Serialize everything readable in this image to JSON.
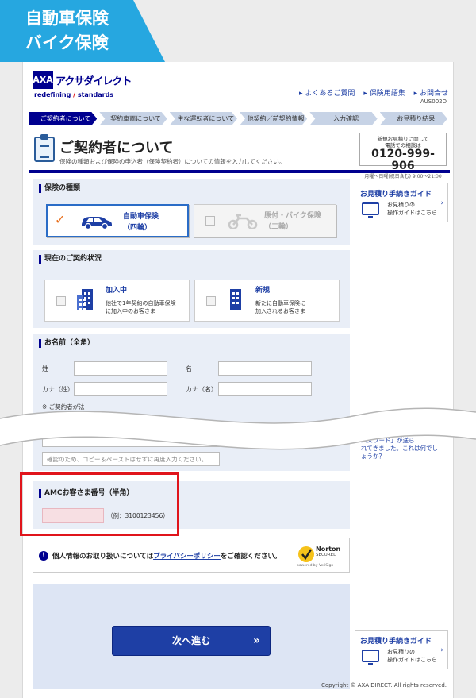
{
  "tag": {
    "line1": "自動車保険",
    "line2": "バイク保険"
  },
  "header": {
    "brand": "アクサダイレクト",
    "tagline_left": "redefining",
    "tagline_right": "standards",
    "links": [
      "よくあるご質問",
      "保険用語集",
      "お問合せ"
    ],
    "page_code": "AUS002D"
  },
  "steps": [
    "ご契約者について",
    "契約車両について",
    "主な運転者について",
    "他契約／前契約情報",
    "入力確認",
    "お見積り結果"
  ],
  "title": {
    "main": "ご契約者について",
    "sub": "保険の種類および保険の申込者（保険契約者）についての情報を入力してください。"
  },
  "phone": {
    "line1": "新規お見積りに関して",
    "line2": "電話での相談は",
    "number": "0120-999-906",
    "hours": "月曜～日曜(祝日含む) 9:00～21:00"
  },
  "insurance_type": {
    "title": "保険の種類",
    "auto": {
      "label1": "自動車保険",
      "label2": "（四輪）"
    },
    "bike": {
      "label1": "原付・バイク保険",
      "label2": "（二輪）"
    }
  },
  "contract_status": {
    "title": "現在のご契約状況",
    "current": {
      "label": "加入中",
      "desc1": "他社で1年契約の自動車保険",
      "desc2": "に加入中のお客さま"
    },
    "new": {
      "label": "新規",
      "desc1": "新たに自動車保険に",
      "desc2": "加入されるお客さま"
    }
  },
  "name": {
    "title": "お名前（全角）",
    "sei": "姓",
    "mei": "名",
    "kana_sei": "カナ（姓）",
    "kana_mei": "カナ（名）",
    "note": "※ ご契約者が法"
  },
  "email_confirm_placeholder": "確認のため、コピー＆ペーストはせずに再度入力ください。",
  "amc": {
    "title": "AMCお客さま番号（半角）",
    "example": "（例：3100123456）"
  },
  "privacy": {
    "prefix": "個人情報のお取り扱いについては",
    "link": "プライバシーポリシー",
    "suffix": "をご確認ください。"
  },
  "norton": {
    "name": "Norton",
    "secured": "SECURED",
    "powered": "powered by VeriSign"
  },
  "next_button": "次へ進む",
  "side_guide": {
    "title": "お見積り手続きガイド",
    "desc1": "お見積りの",
    "desc2": "操作ガイドはこちら"
  },
  "side_partial": {
    "line1": "パスワード」が送ら",
    "line2": "れてきました。これは何でし",
    "line3": "ょうか？"
  },
  "copyright": "Copyright © AXA DIRECT. All rights reserved."
}
